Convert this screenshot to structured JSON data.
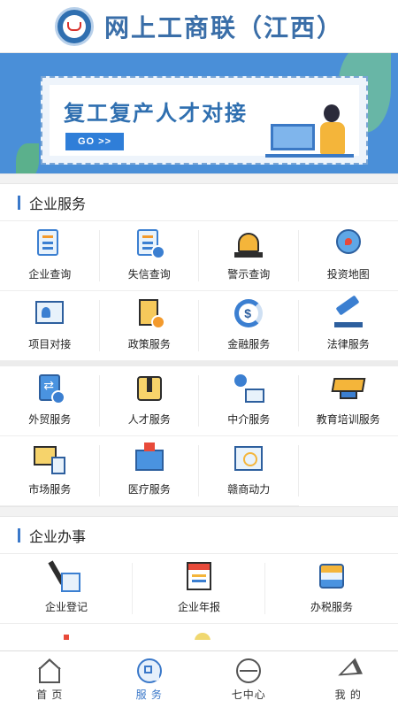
{
  "header": {
    "title": "网上工商联（江西）"
  },
  "banner": {
    "title": "复工复产人才对接",
    "go_label": "GO >>"
  },
  "enterprise_services": {
    "title": "企业服务",
    "group1": [
      {
        "label": "企业查询",
        "icon": "enterprise-search-icon"
      },
      {
        "label": "失信查询",
        "icon": "credit-search-icon"
      },
      {
        "label": "警示查询",
        "icon": "alarm-lamp-icon"
      },
      {
        "label": "投资地图",
        "icon": "globe-map-icon"
      },
      {
        "label": "项目对接",
        "icon": "project-frame-icon"
      },
      {
        "label": "政策服务",
        "icon": "policy-document-icon"
      },
      {
        "label": "金融服务",
        "icon": "finance-coin-icon"
      },
      {
        "label": "法律服务",
        "icon": "gavel-icon"
      }
    ],
    "group2": [
      {
        "label": "外贸服务",
        "icon": "trade-exchange-icon"
      },
      {
        "label": "人才服务",
        "icon": "suit-tie-icon"
      },
      {
        "label": "中介服务",
        "icon": "agent-person-icon"
      },
      {
        "label": "教育培训服务",
        "icon": "graduation-cap-icon"
      },
      {
        "label": "市场服务",
        "icon": "chart-calculator-icon"
      },
      {
        "label": "医疗服务",
        "icon": "hospital-icon"
      },
      {
        "label": "赣商动力",
        "icon": "network-icon"
      }
    ]
  },
  "enterprise_affairs": {
    "title": "企业办事",
    "items": [
      {
        "label": "企业登记",
        "icon": "pen-form-icon"
      },
      {
        "label": "企业年报",
        "icon": "annual-report-icon"
      },
      {
        "label": "办税服务",
        "icon": "tax-drawer-icon"
      }
    ]
  },
  "tabbar": {
    "active": "服 务",
    "tabs": [
      {
        "label": "首 页",
        "icon": "home-icon"
      },
      {
        "label": "服 务",
        "icon": "services-grid-icon"
      },
      {
        "label": "七中心",
        "icon": "seven-center-icon"
      },
      {
        "label": "我 的",
        "icon": "paper-plane-icon"
      }
    ]
  },
  "colors": {
    "accent": "#3a78c9",
    "title_blue": "#3a6ea8",
    "banner_bg": "#4a8fd8"
  }
}
